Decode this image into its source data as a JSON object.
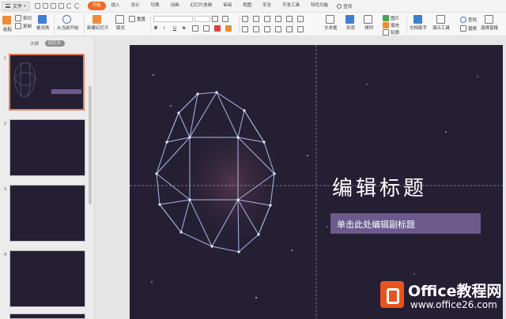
{
  "menubar": {
    "file_label": "文件",
    "tabs": [
      "开始",
      "插入",
      "设计",
      "切换",
      "动画",
      "幻灯片放映",
      "审阅",
      "视图",
      "安全",
      "开发工具",
      "特色功能"
    ],
    "search_label": "查找"
  },
  "ribbon": {
    "paste": "粘贴",
    "cut": "剪切",
    "copy": "复制",
    "format_painter": "格式刷",
    "from_current": "从当前开始",
    "new_slide": "新建幻灯片",
    "layout": "版式",
    "reset": "重置",
    "textbox": "文本框",
    "shape": "形状",
    "arrange": "排列",
    "picture": "图片",
    "fill": "填充",
    "outline": "轮廓",
    "doc_assistant": "文档助手",
    "presentation_tools": "演示工具",
    "find": "查找",
    "replace": "替换",
    "select_pane": "选择窗格",
    "bold": "B",
    "italic": "I",
    "underline": "U",
    "strikethrough": "S"
  },
  "left_panel": {
    "outline_tab": "大纲",
    "slides_tab": "幻灯片",
    "slide_numbers": [
      "1",
      "2",
      "3",
      "4"
    ]
  },
  "slide": {
    "title": "编辑标题",
    "subtitle": "单击此处编辑副标题"
  },
  "watermark": {
    "name": "Office教程网",
    "url": "www.office26.com"
  },
  "colors": {
    "accent": "#f06a25",
    "slide_bg": "#251f34",
    "subtitle_box": "#6c5a8d"
  }
}
